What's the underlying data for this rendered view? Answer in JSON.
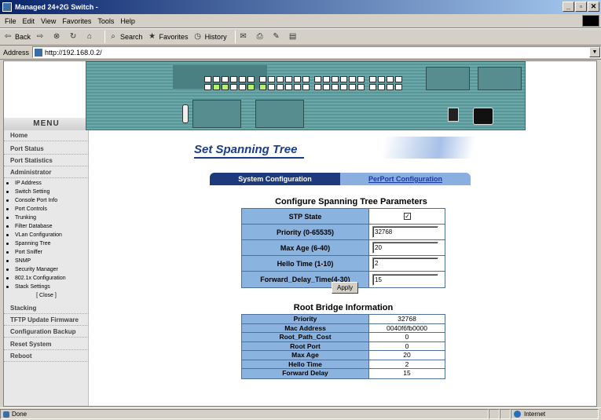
{
  "window": {
    "title": "Managed 24+2G Switch -",
    "controls": [
      "_",
      "▫",
      "✕"
    ]
  },
  "menubar": [
    "File",
    "Edit",
    "View",
    "Favorites",
    "Tools",
    "Help"
  ],
  "toolbar": {
    "back": "Back",
    "search": "Search",
    "favorites": "Favorites",
    "history": "History"
  },
  "address": {
    "label": "Address",
    "url": "http://192.168.0.2/"
  },
  "sidebar": {
    "title": "MENU",
    "items_top": [
      "Home",
      "Port Status",
      "Port Statistics",
      "Administrator"
    ],
    "sub_items": [
      "IP Address",
      "Switch Setting",
      "Console Port Info",
      "Port Controls",
      "Trunking",
      "Filter Database",
      "VLan Configuration",
      "Spanning Tree",
      "Port Sniffer",
      "SNMP",
      "Security Manager",
      "802.1x Configuration",
      "Stack Settings"
    ],
    "close": "[ Close ]",
    "items_bottom": [
      "Stacking",
      "TFTP Update Firmware",
      "Configuration Backup",
      "Reset System",
      "Reboot"
    ]
  },
  "page": {
    "title": "Set Spanning Tree",
    "tabs": {
      "system": "System Configuration",
      "perport": "PerPort Configuration"
    },
    "config_title": "Configure Spanning Tree Parameters",
    "config_rows": [
      {
        "label": "STP State",
        "value": "✓"
      },
      {
        "label": "Priority (0-65535)",
        "value": "32768"
      },
      {
        "label": "Max Age (6-40)",
        "value": "20"
      },
      {
        "label": "Hello Time (1-10)",
        "value": "2"
      },
      {
        "label": "Forward_Delay_Time(4-30)",
        "value": "15"
      }
    ],
    "apply": "Apply",
    "root_title": "Root Bridge Information",
    "root_rows": [
      {
        "label": "Priority",
        "value": "32768"
      },
      {
        "label": "Mac Address",
        "value": "0040f6fb0000"
      },
      {
        "label": "Root_Path_Cost",
        "value": "0"
      },
      {
        "label": "Root Port",
        "value": "0"
      },
      {
        "label": "Max Age",
        "value": "20"
      },
      {
        "label": "Hello Time",
        "value": "2"
      },
      {
        "label": "Forward Delay",
        "value": "15"
      }
    ]
  },
  "status": {
    "text": "Done",
    "zone": "Internet"
  }
}
